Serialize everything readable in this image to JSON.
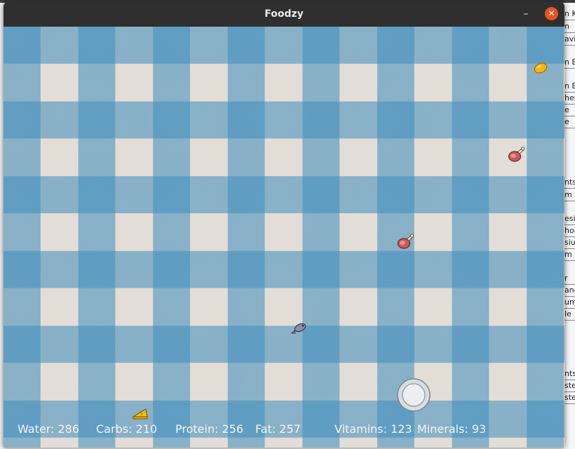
{
  "window": {
    "title": "Foodzy",
    "minimize_icon": "minimize-icon",
    "close_icon": "close-icon"
  },
  "background_sheet": {
    "fragments": [
      "n K",
      "n",
      "avin",
      "n B",
      "n B",
      "her",
      "e",
      "e",
      "nts",
      "m",
      "esiu",
      "hor",
      "siu",
      "m",
      "r",
      "ane",
      "um",
      "le",
      "nts",
      "ster",
      "ster"
    ]
  },
  "game": {
    "foods": [
      {
        "name": "lemon",
        "icon": "lemon-icon"
      },
      {
        "name": "meat",
        "icon": "meat-drumstick-icon"
      },
      {
        "name": "meat",
        "icon": "meat-drumstick-icon"
      },
      {
        "name": "fish",
        "icon": "fish-icon"
      },
      {
        "name": "cheese",
        "icon": "cheese-icon"
      }
    ],
    "player": {
      "icon": "plate-icon"
    },
    "hud": {
      "water": "Water: 286",
      "carbs": "Carbs: 210",
      "protein": "Protein: 256",
      "fat": "Fat: 257",
      "vitamins": "Vitamins: 123",
      "minerals": "Minerals: 93"
    }
  },
  "colors": {
    "tablecloth_blue": "#3f8dbd",
    "tablecloth_cream": "#e2ddd6",
    "titlebar": "#2f2f2f",
    "close_button": "#e95420"
  }
}
